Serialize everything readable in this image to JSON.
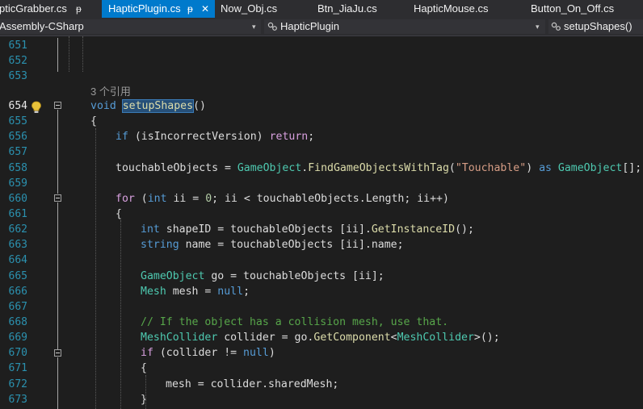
{
  "tabs": [
    {
      "label": "pticGrabber.cs",
      "pinned": true
    },
    {
      "label": "HapticPlugin.cs",
      "active": true,
      "pinned": true
    },
    {
      "label": "Now_Obj.cs"
    },
    {
      "label": "Btn_JiaJu.cs"
    },
    {
      "label": "HapticMouse.cs"
    },
    {
      "label": "Button_On_Off.cs"
    }
  ],
  "glyphs": {
    "pin": "ᵽ",
    "close": "✕",
    "dropdown": "▾"
  },
  "navbar": {
    "project": "Assembly-CSharp",
    "type_name": "HapticPlugin",
    "member": "setupShapes()"
  },
  "codelens": "3 个引用",
  "line_numbers": [
    "651",
    "652",
    "653",
    "654",
    "655",
    "656",
    "657",
    "658",
    "659",
    "660",
    "661",
    "662",
    "663",
    "664",
    "665",
    "666",
    "667",
    "668",
    "669",
    "670",
    "671",
    "672",
    "673"
  ],
  "code": {
    "l654": {
      "void": "void",
      "name": "setupShapes",
      "paren": "()"
    },
    "l655": "{",
    "l656": {
      "if": "if",
      "cond": " (isIncorrectVersion) ",
      "ret": "return",
      "semi": ";"
    },
    "l658": {
      "var": "touchableObjects = ",
      "type": "GameObject",
      "dot": ".",
      "method": "FindGameObjectsWithTag",
      "open": "(",
      "str": "\"Touchable\"",
      "close": ") ",
      "as": "as",
      "sp": " ",
      "type2": "GameObject",
      "end": "[];"
    },
    "l660": {
      "for": "for",
      "a": " (",
      "int": "int",
      "b": " ii = ",
      "zero": "0",
      "c": "; ii < touchableObjects.Length; ii++)"
    },
    "l661": "{",
    "l662": {
      "int": "int",
      "a": " shapeID = touchableObjects [ii].",
      "method": "GetInstanceID",
      "b": "();"
    },
    "l663": {
      "string": "string",
      "a": " name = touchableObjects [ii].name;"
    },
    "l665": {
      "type": "GameObject",
      "a": " go = touchableObjects [ii];"
    },
    "l666": {
      "type": "Mesh",
      "a": " mesh = ",
      "null": "null",
      "b": ";"
    },
    "l668": "// If the object has a collision mesh, use that.",
    "l669": {
      "type": "MeshCollider",
      "a": " collider = go.",
      "method": "GetComponent",
      "lt": "<",
      "type2": "MeshCollider",
      "b": ">();"
    },
    "l670": {
      "if": "if",
      "a": " (collider != ",
      "null": "null",
      "b": ")"
    },
    "l671": "{",
    "l672": "mesh = collider.sharedMesh;",
    "l673": "}"
  }
}
